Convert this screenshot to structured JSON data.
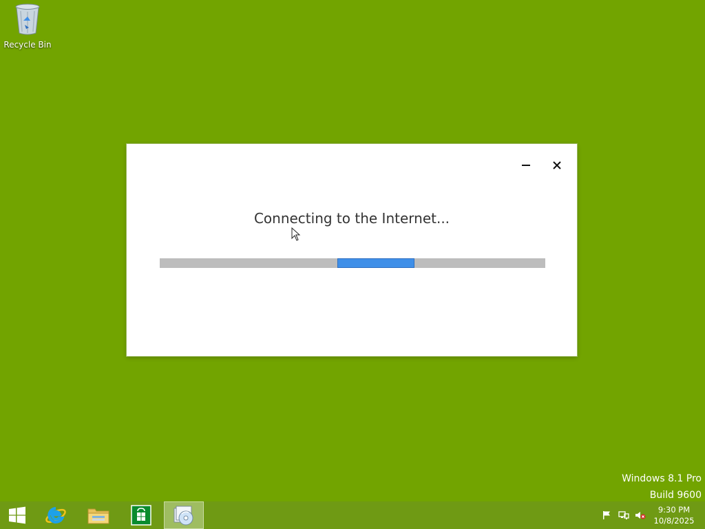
{
  "desktop": {
    "icons": [
      {
        "label": "Recycle Bin",
        "icon": "recycle-bin-icon"
      }
    ]
  },
  "dialog": {
    "title": "Connecting to the Internet...",
    "progress": {
      "mode": "indeterminate",
      "chunk_start": 0.46,
      "chunk_end": 0.66
    },
    "controls": {
      "minimize": "minimize-icon",
      "close": "close-icon"
    }
  },
  "watermark": {
    "line1": "Windows 8.1 Pro",
    "line2": "Build 9600"
  },
  "taskbar": {
    "items": [
      {
        "name": "start",
        "icon": "windows-logo-icon"
      },
      {
        "name": "internet-explorer",
        "icon": "internet-explorer-icon"
      },
      {
        "name": "file-explorer",
        "icon": "folder-icon"
      },
      {
        "name": "store",
        "icon": "store-icon"
      },
      {
        "name": "setup",
        "icon": "setup-disc-icon",
        "active": true
      }
    ],
    "tray": {
      "icons": [
        "action-center-flag-icon",
        "network-icon",
        "volume-muted-icon"
      ],
      "time": "9:30 PM",
      "date": "10/8/2025"
    }
  },
  "colors": {
    "desktop_background": "#72a400",
    "progress_fill": "#3f8fe8",
    "progress_track": "#bdbdbd"
  }
}
